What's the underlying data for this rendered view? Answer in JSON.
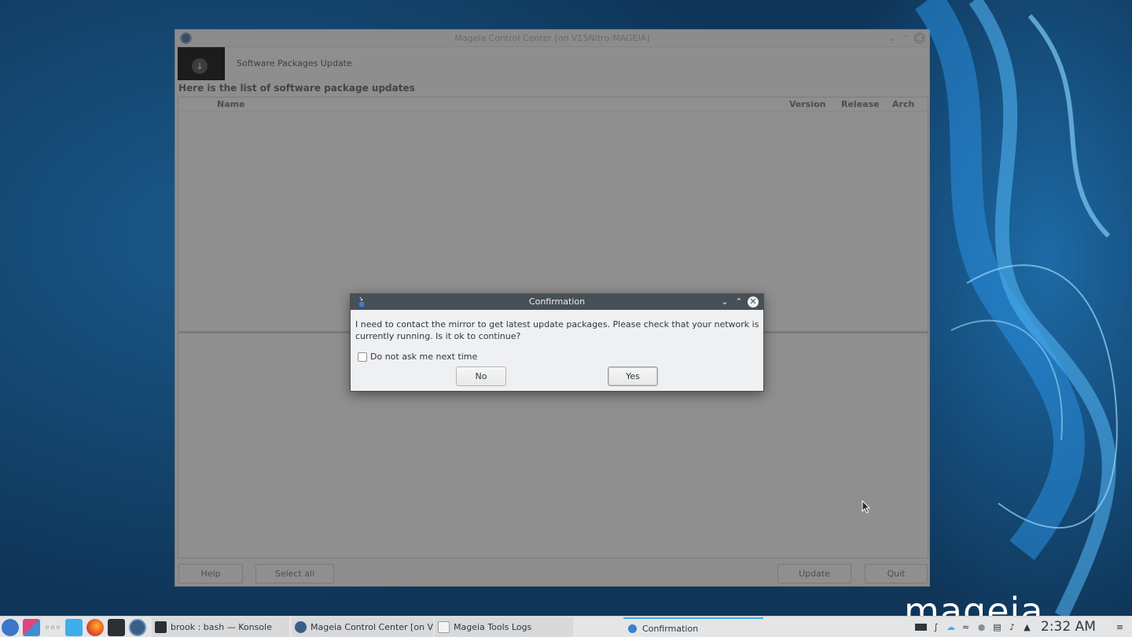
{
  "main_window": {
    "title": "Mageia Control Center [on V15Nitro-MAGEIA]",
    "banner_title": "Software Packages Update",
    "list_heading": "Here is the list of software package updates",
    "columns": [
      "Name",
      "Version",
      "Release",
      "Arch"
    ],
    "buttons": {
      "help": "Help",
      "select_all": "Select all",
      "update": "Update",
      "quit": "Quit"
    }
  },
  "dialog": {
    "title": "Confirmation",
    "message": "I need to contact the mirror to get latest update packages. Please check that your network is currently running. Is it ok to continue?",
    "checkbox_label": "Do not ask me next time",
    "checkbox_checked": false,
    "no_label": "No",
    "yes_label": "Yes"
  },
  "taskbar": {
    "tasks": [
      {
        "label": "brook : bash — Konsole",
        "icon": "terminal-icon"
      },
      {
        "label": "Mageia Control Center  [on V...",
        "icon": "mageia-control-center-icon"
      },
      {
        "label": "Mageia Tools Logs",
        "icon": "document-icon"
      },
      {
        "label": "Confirmation",
        "icon": "mageia-dialog-icon"
      }
    ],
    "launchers": [
      "mageia-menu-icon",
      "desktop-icon",
      "more-icon",
      "file-manager-icon",
      "firefox-icon",
      "terminal-icon",
      "control-center-icon"
    ],
    "clock": "2:32 AM"
  },
  "desktop": {
    "logo": "mageia"
  },
  "colors": {
    "accent": "#3daee9",
    "dialog_titlebar": "#475057",
    "dialog_bg": "#eff0f1"
  }
}
